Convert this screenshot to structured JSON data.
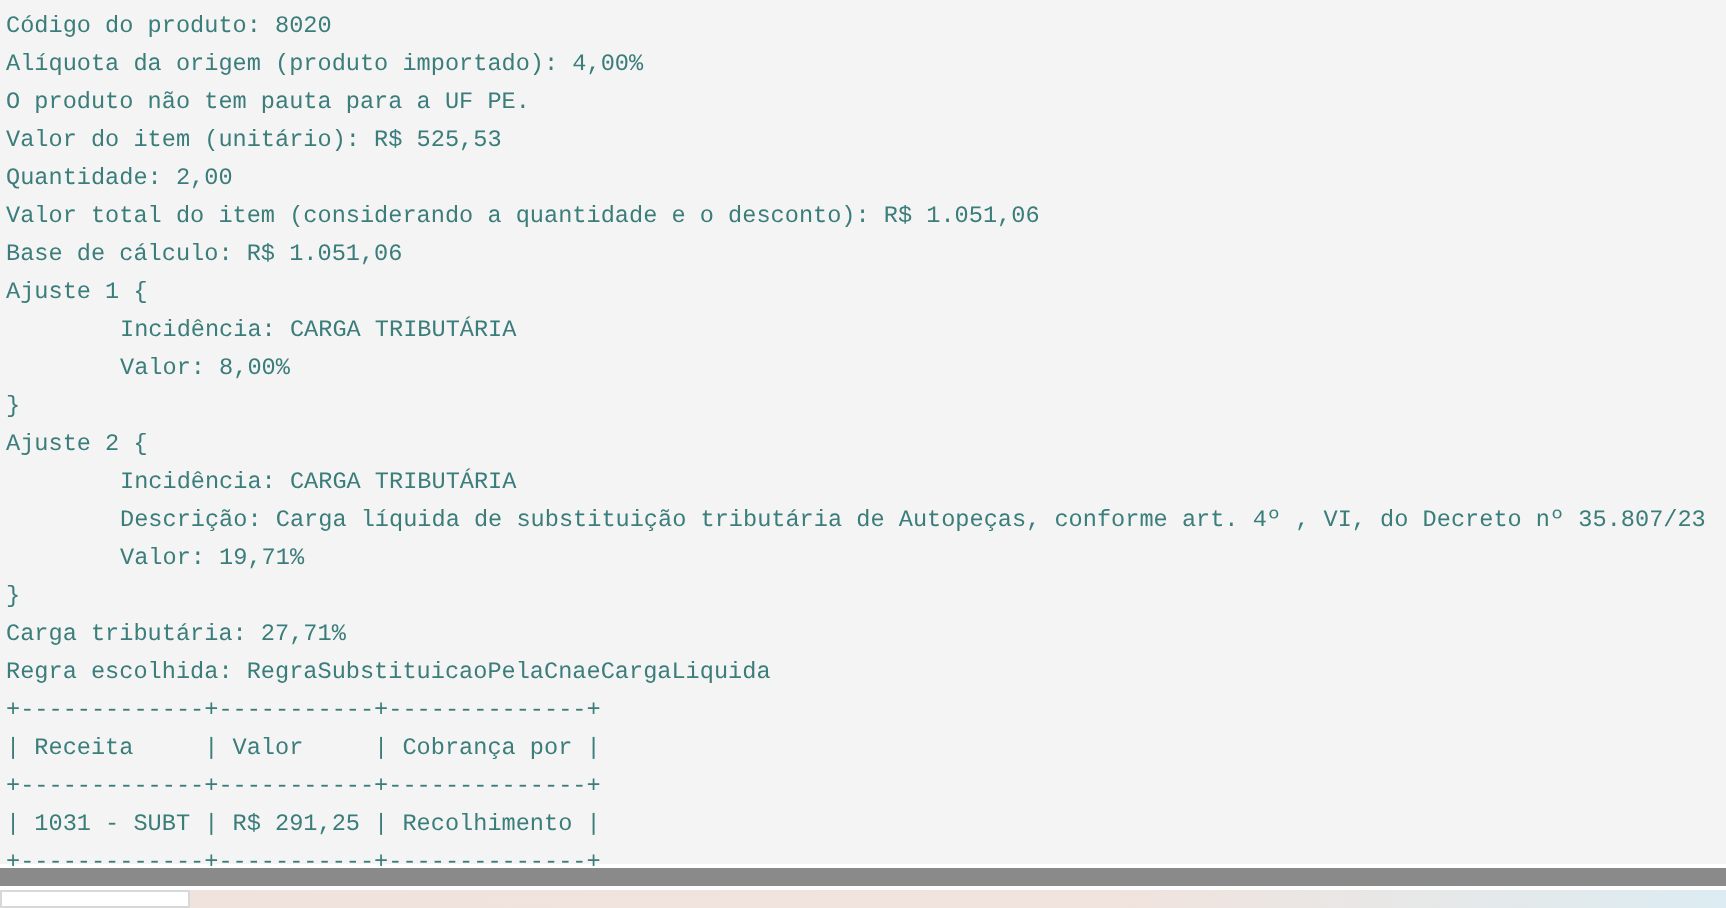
{
  "console": {
    "lines": [
      {
        "kind": "text",
        "text": "Código do produto: 8020"
      },
      {
        "kind": "text",
        "text": "Alíquota da origem (produto importado): 4,00%"
      },
      {
        "kind": "text",
        "text": "O produto não tem pauta para a UF PE."
      },
      {
        "kind": "text",
        "text": "Valor do item (unitário): R$ 525,53"
      },
      {
        "kind": "text",
        "text": "Quantidade: 2,00"
      },
      {
        "kind": "text",
        "text": "Valor total do item (considerando a quantidade e o desconto): R$ 1.051,06"
      },
      {
        "kind": "text",
        "text": "Base de cálculo: R$ 1.051,06"
      },
      {
        "kind": "block",
        "open": "Ajuste 1 {",
        "children": [
          "Incidência: CARGA TRIBUTÁRIA",
          "Valor: 8,00%"
        ],
        "close": "}"
      },
      {
        "kind": "block",
        "open": "Ajuste 2 {",
        "children": [
          "Incidência: CARGA TRIBUTÁRIA",
          "Descrição: Carga líquida de substituição tributária de Autopeças, conforme art. 4º , VI, do Decreto nº 35.807/23",
          "Valor: 19,71%"
        ],
        "close": "}"
      },
      {
        "kind": "text",
        "text": "Carga tributária: 27,71%"
      },
      {
        "kind": "text",
        "text": "Regra escolhida: RegraSubstituicaoPelaCnaeCargaLiquida"
      },
      {
        "kind": "rule",
        "text": "+-------------+-----------+--------------+"
      },
      {
        "kind": "row",
        "text": "| Receita     | Valor     | Cobrança por |"
      },
      {
        "kind": "rule",
        "text": "+-------------+-----------+--------------+"
      },
      {
        "kind": "row",
        "text": "| 1031 - SUBT | R$ 291,25 | Recolhimento |"
      },
      {
        "kind": "rule",
        "text": "+-------------+-----------+--------------+"
      }
    ]
  }
}
